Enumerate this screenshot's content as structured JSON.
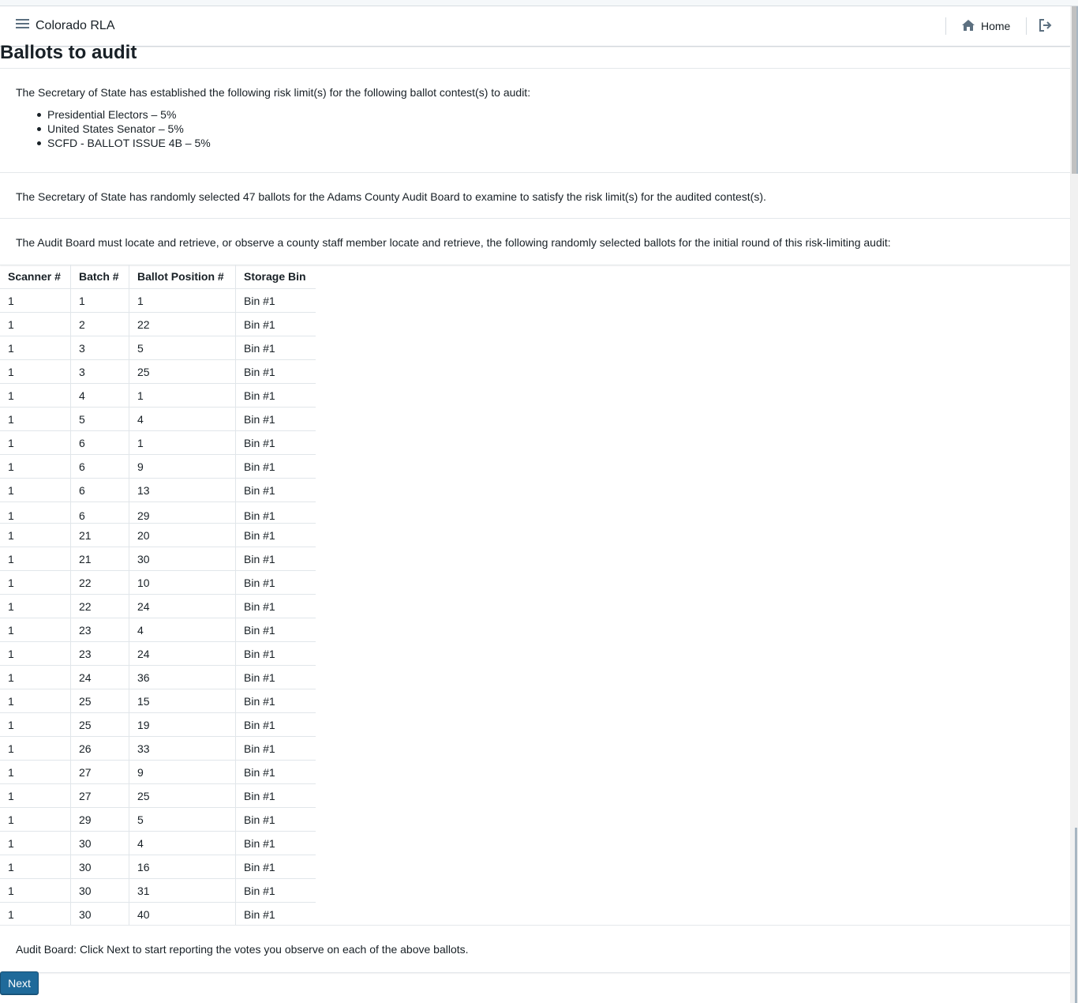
{
  "navbar": {
    "title": "Colorado RLA",
    "home_label": "Home",
    "menu_icon": "hamburger-menu-icon",
    "home_icon": "home-icon",
    "logout_icon": "log-out-icon"
  },
  "page_title": "Ballots to audit",
  "risk_limits": {
    "intro": "The Secretary of State has established the following risk limit(s) for the following ballot contest(s) to audit:",
    "contests": [
      "Presidential Electors – 5%",
      "United States Senator – 5%",
      "SCFD - BALLOT ISSUE 4B – 5%"
    ]
  },
  "selection_text": "The Secretary of State has randomly selected 47 ballots for the Adams County Audit Board to examine to satisfy the risk limit(s) for the audited contest(s).",
  "retrieve_text": "The Audit Board must locate and retrieve, or observe a county staff member locate and retrieve, the following randomly selected ballots for the initial round of this risk-limiting audit:",
  "table": {
    "headers": [
      "Scanner #",
      "Batch #",
      "Ballot Position #",
      "Storage Bin"
    ],
    "rows": [
      [
        "1",
        "1",
        "1",
        "Bin #1"
      ],
      [
        "1",
        "2",
        "22",
        "Bin #1"
      ],
      [
        "1",
        "3",
        "5",
        "Bin #1"
      ],
      [
        "1",
        "3",
        "25",
        "Bin #1"
      ],
      [
        "1",
        "4",
        "1",
        "Bin #1"
      ],
      [
        "1",
        "5",
        "4",
        "Bin #1"
      ],
      [
        "1",
        "6",
        "1",
        "Bin #1"
      ],
      [
        "1",
        "6",
        "9",
        "Bin #1"
      ],
      [
        "1",
        "6",
        "13",
        "Bin #1"
      ],
      [
        "1",
        "6",
        "29",
        "Bin #1"
      ],
      [
        "1",
        "21",
        "20",
        "Bin #1"
      ],
      [
        "1",
        "21",
        "30",
        "Bin #1"
      ],
      [
        "1",
        "22",
        "10",
        "Bin #1"
      ],
      [
        "1",
        "22",
        "24",
        "Bin #1"
      ],
      [
        "1",
        "23",
        "4",
        "Bin #1"
      ],
      [
        "1",
        "23",
        "24",
        "Bin #1"
      ],
      [
        "1",
        "24",
        "36",
        "Bin #1"
      ],
      [
        "1",
        "25",
        "15",
        "Bin #1"
      ],
      [
        "1",
        "25",
        "19",
        "Bin #1"
      ],
      [
        "1",
        "26",
        "33",
        "Bin #1"
      ],
      [
        "1",
        "27",
        "9",
        "Bin #1"
      ],
      [
        "1",
        "27",
        "25",
        "Bin #1"
      ],
      [
        "1",
        "29",
        "5",
        "Bin #1"
      ],
      [
        "1",
        "30",
        "4",
        "Bin #1"
      ],
      [
        "1",
        "30",
        "16",
        "Bin #1"
      ],
      [
        "1",
        "30",
        "31",
        "Bin #1"
      ],
      [
        "1",
        "30",
        "40",
        "Bin #1"
      ]
    ]
  },
  "footer_text": "Audit Board: Click Next to start reporting the votes you observe on each of the above ballots.",
  "next_label": "Next",
  "colors": {
    "primary_button": "#1f6a9a",
    "text": "#182026",
    "border": "#e1e6ea"
  }
}
